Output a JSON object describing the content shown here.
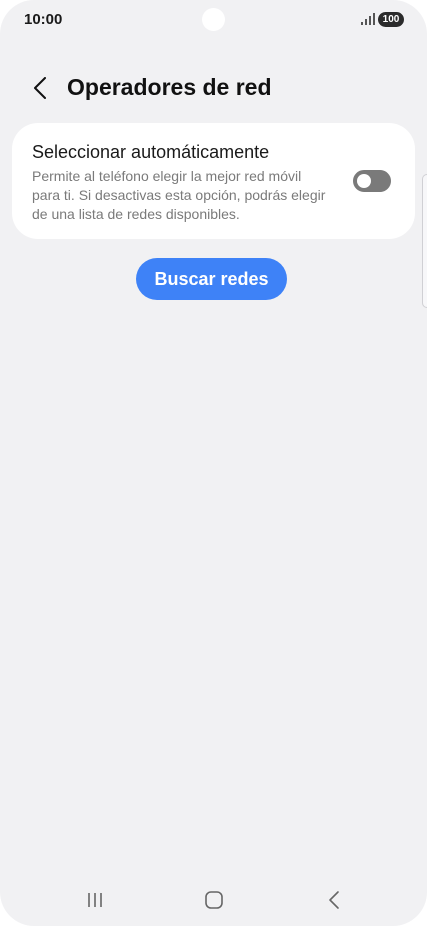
{
  "status_bar": {
    "time": "10:00",
    "battery": "100",
    "signal_icon": "signal-icon"
  },
  "header": {
    "back_icon": "chevron-left-icon",
    "title": "Operadores de red"
  },
  "auto_select": {
    "title": "Seleccionar automáticamente",
    "description": "Permite al teléfono elegir la mejor red móvil para ti. Si desactivas esta opción, podrás elegir de una lista de redes disponibles.",
    "enabled": false
  },
  "search_button": {
    "label": "Buscar redes"
  },
  "nav_bar": {
    "recents_icon": "recents-icon",
    "home_icon": "home-icon",
    "back_icon": "back-icon"
  },
  "colors": {
    "background": "#f1f1f3",
    "card": "#ffffff",
    "accent": "#3e82f7",
    "toggle_off": "#7a7a7a",
    "text_secondary": "#7a7a7a"
  }
}
